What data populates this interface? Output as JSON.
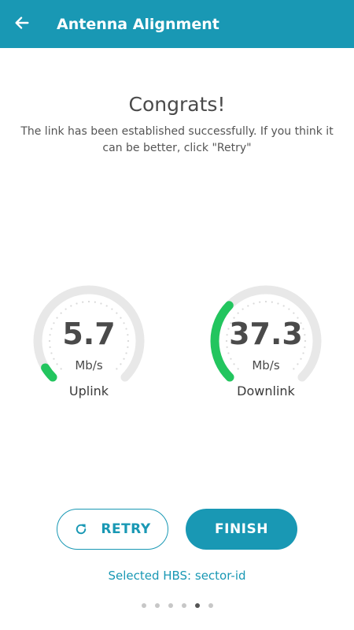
{
  "appbar": {
    "title": "Antenna Alignment",
    "back_icon": "arrow-left-icon",
    "background": "#1998b4"
  },
  "result": {
    "heading": "Congrats!",
    "message": "The link has been established successfully. If you think it can be better, click \"Retry\""
  },
  "gauges": [
    {
      "id": "uplink",
      "value": "5.7",
      "unit": "Mb/s",
      "label": "Uplink",
      "level_fraction": 0.05,
      "arc_color": "#22c55e",
      "track_color": "#e8e8e8"
    },
    {
      "id": "downlink",
      "value": "37.3",
      "unit": "Mb/s",
      "label": "Downlink",
      "level_fraction": 0.33,
      "arc_color": "#22c55e",
      "track_color": "#e8e8e8"
    }
  ],
  "actions": {
    "retry_label": "RETRY",
    "retry_icon": "refresh-icon",
    "finish_label": "FINISH"
  },
  "footer": {
    "selected_hbs": "Selected HBS: sector-id"
  },
  "pager": {
    "count": 6,
    "active_index": 4
  }
}
